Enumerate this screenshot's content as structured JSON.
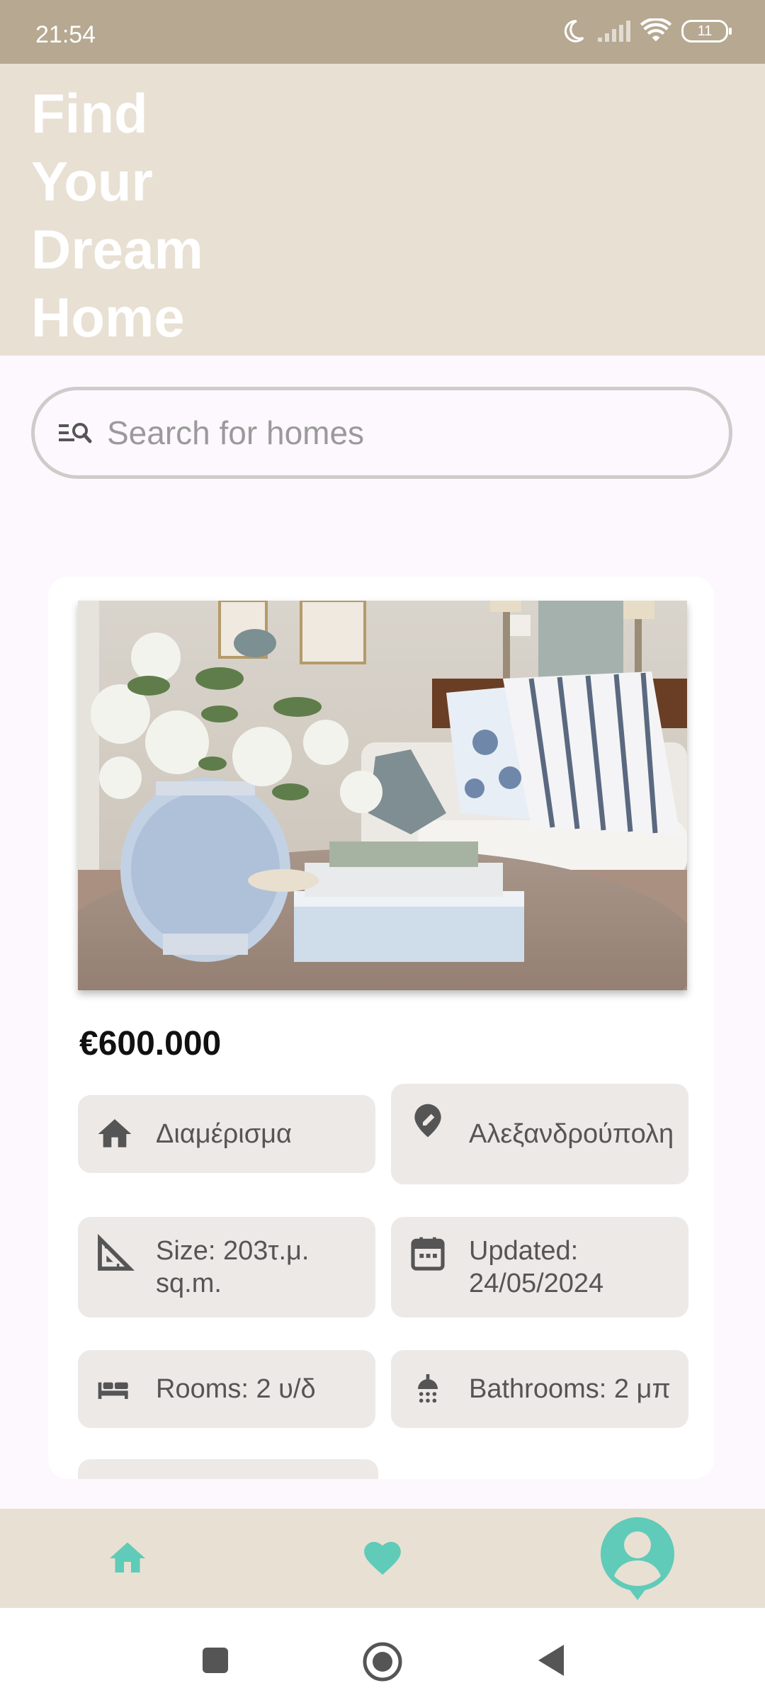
{
  "status": {
    "time": "21:54",
    "battery": "11"
  },
  "header": {
    "title": "Find Your Dream Home"
  },
  "search": {
    "placeholder": "Search for homes"
  },
  "listing": {
    "image_alt": "Living room with flower vase, books and sofa",
    "price": "€600.000",
    "type": "Διαμέρισμα",
    "location": "Αλεξανδρούπολη",
    "size": "Size: 203τ.μ. sq.m.",
    "updated": "Updated: 24/05/2024",
    "rooms": "Rooms: 2 υ/δ",
    "bathrooms": "Bathrooms: 2 μπ"
  },
  "nav": {
    "items": [
      "home",
      "favorites",
      "profile"
    ]
  },
  "colors": {
    "status_bar": "#b6a891",
    "header_bg": "#e8e0d3",
    "accent_teal": "#5fcbb8",
    "chip_bg": "#ede9e7",
    "page_bg": "#fdf8fd"
  },
  "icons": [
    "moon-icon",
    "signal-icon",
    "wifi-icon",
    "battery-icon",
    "search-filter-icon",
    "home-icon",
    "location-edit-icon",
    "ruler-icon",
    "calendar-icon",
    "bed-icon",
    "shower-icon",
    "heart-icon",
    "account-icon",
    "square-icon",
    "circle-icon",
    "back-icon"
  ]
}
